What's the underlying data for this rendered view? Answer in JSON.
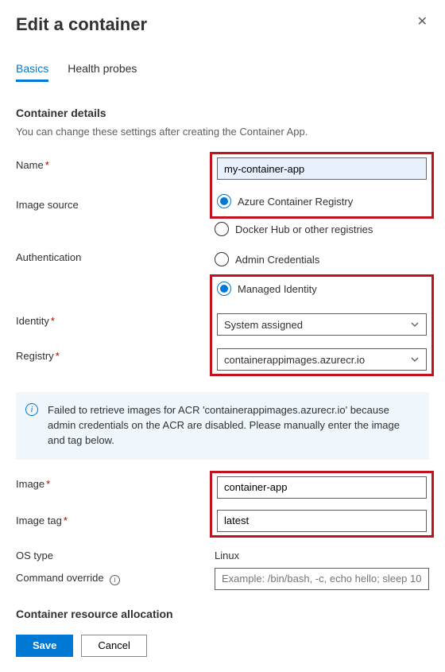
{
  "header": {
    "title": "Edit a container"
  },
  "tabs": {
    "basics": "Basics",
    "health": "Health probes"
  },
  "section": {
    "details_title": "Container details",
    "details_desc": "You can change these settings after creating the Container App.",
    "resource_title": "Container resource allocation"
  },
  "labels": {
    "name": "Name",
    "image_source": "Image source",
    "authentication": "Authentication",
    "identity": "Identity",
    "registry": "Registry",
    "image": "Image",
    "image_tag": "Image tag",
    "os_type": "OS type",
    "command_override": "Command override"
  },
  "values": {
    "name": "my-container-app",
    "identity": "System assigned",
    "registry": "containerappimages.azurecr.io",
    "image": "container-app",
    "image_tag": "latest",
    "os_type": "Linux",
    "command_override_placeholder": "Example: /bin/bash, -c, echo hello; sleep 10..."
  },
  "radio": {
    "acr": "Azure Container Registry",
    "docker": "Docker Hub or other registries",
    "admin": "Admin Credentials",
    "managed": "Managed Identity"
  },
  "message": {
    "acr_warning": "Failed to retrieve images for ACR 'containerappimages.azurecr.io' because admin credentials on the ACR are disabled. Please manually enter the image and tag below."
  },
  "buttons": {
    "save": "Save",
    "cancel": "Cancel"
  }
}
